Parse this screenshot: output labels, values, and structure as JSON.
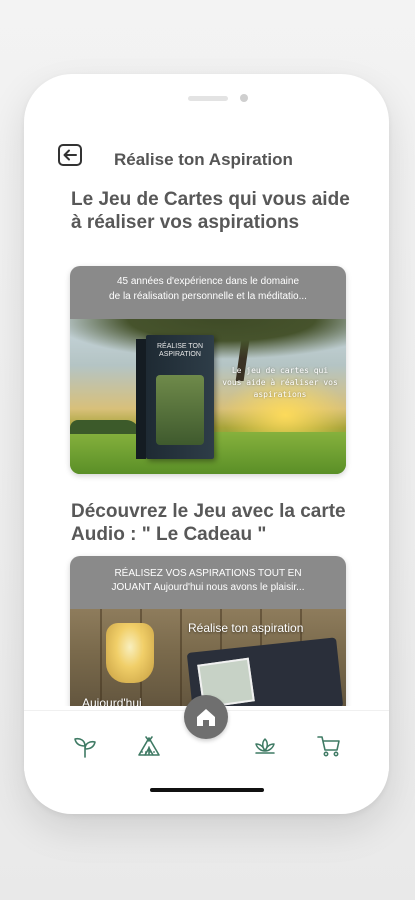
{
  "header": {
    "back_label": "Retour",
    "title": "Réalise ton Aspiration"
  },
  "sections": [
    {
      "heading": "Le Jeu de Cartes qui vous aide à réaliser vos aspirations",
      "caption_line1": "45 années d'expérience dans le domaine",
      "caption_line2": "de la réalisation personnelle et la méditatio...",
      "box_text": "RÉALISE TON ASPIRATION",
      "overlay_text": "Le jeu de cartes qui vous aide à réaliser vos aspirations"
    },
    {
      "heading": "Découvrez le Jeu avec la carte Audio : \" Le Cadeau \"",
      "caption_line1": "RÉALISEZ VOS ASPIRATIONS TOUT EN",
      "caption_line2": "JOUANT    Aujourd'hui nous avons le plaisir...",
      "video_title": "Réalise ton aspiration",
      "video_bottom": "Aujourd'hui"
    }
  ],
  "tabbar": {
    "tabs": [
      {
        "icon": "sprout-icon"
      },
      {
        "icon": "tent-icon"
      },
      {
        "icon": "home-icon"
      },
      {
        "icon": "lotus-icon"
      },
      {
        "icon": "cart-icon"
      }
    ],
    "accent_color": "#3f7a64",
    "home_bg": "#6f6f6f"
  }
}
